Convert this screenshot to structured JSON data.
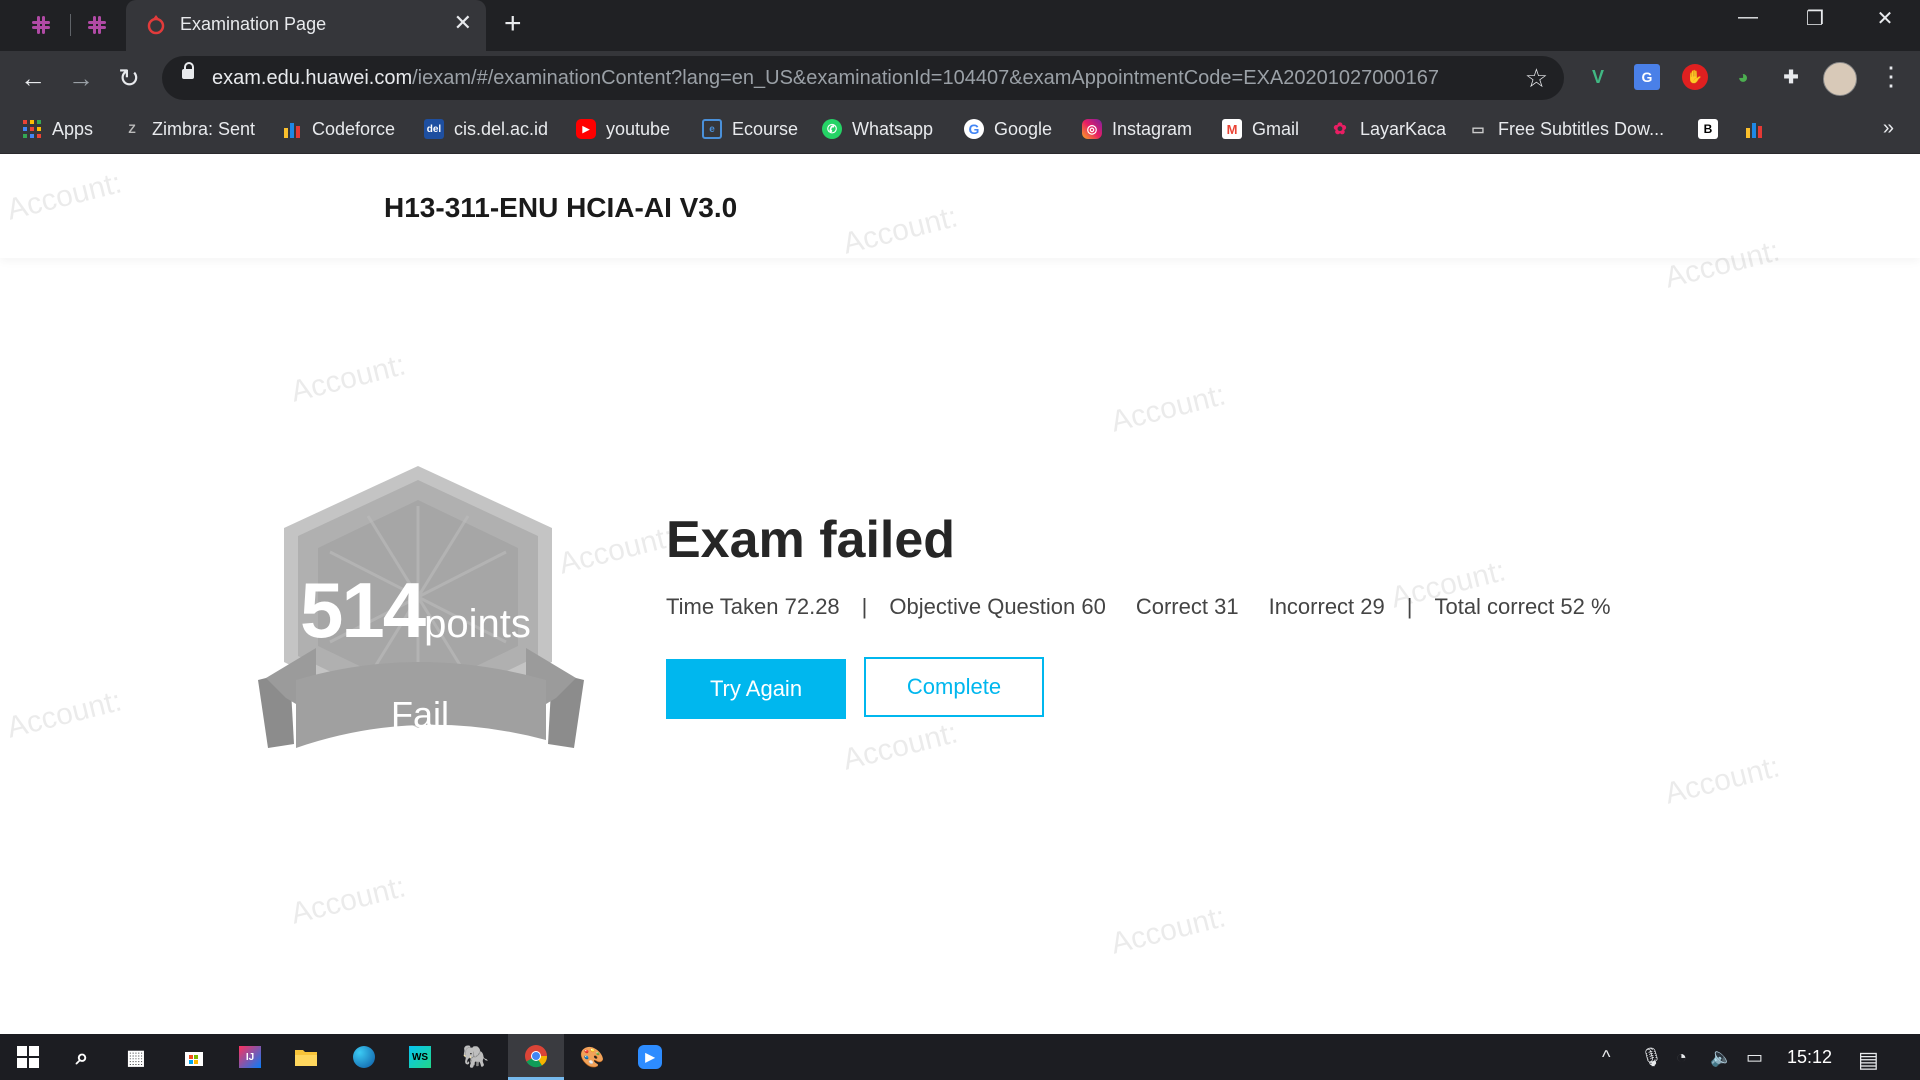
{
  "browser": {
    "pinned_tabs": [
      "slack-icon",
      "slack-icon"
    ],
    "active_tab_title": "Examination Page",
    "url_host": "exam.edu.huawei.com",
    "url_path": "/iexam/#/examinationContent?lang=en_US&examinationId=104407&examAppointmentCode=EXA20201027000167",
    "bookmarks": [
      {
        "label": "Apps",
        "icon": "apps-grid-icon"
      },
      {
        "label": "Zimbra: Sent",
        "icon": "zimbra-icon"
      },
      {
        "label": "Codeforce",
        "icon": "codeforces-icon"
      },
      {
        "label": "cis.del.ac.id",
        "icon": "del-icon"
      },
      {
        "label": "youtube",
        "icon": "youtube-icon"
      },
      {
        "label": "Ecourse",
        "icon": "ecourse-icon"
      },
      {
        "label": "Whatsapp",
        "icon": "whatsapp-icon"
      },
      {
        "label": "Google",
        "icon": "google-icon"
      },
      {
        "label": "Instagram",
        "icon": "instagram-icon"
      },
      {
        "label": "Gmail",
        "icon": "gmail-icon"
      },
      {
        "label": "LayarKaca",
        "icon": "layarkaca-icon"
      },
      {
        "label": "Free Subtitles Dow...",
        "icon": "subtitles-icon"
      }
    ]
  },
  "page": {
    "exam_title": "H13-311-ENU HCIA-AI V3.0",
    "watermark_text": "Account:",
    "badge": {
      "score": "514",
      "unit": "points",
      "status": "Fail"
    },
    "result": {
      "title": "Exam failed",
      "time_taken": "Time Taken 72.28",
      "objective_question": "Objective Question 60",
      "correct": "Correct 31",
      "incorrect": "Incorrect 29",
      "total_correct": "Total correct 52 %",
      "separator": "|"
    },
    "buttons": {
      "try_again": "Try Again",
      "complete": "Complete"
    }
  },
  "taskbar": {
    "clock": "15:12"
  },
  "colors": {
    "accent": "#00b7ee",
    "badge_gray": "#b3b3b3"
  }
}
